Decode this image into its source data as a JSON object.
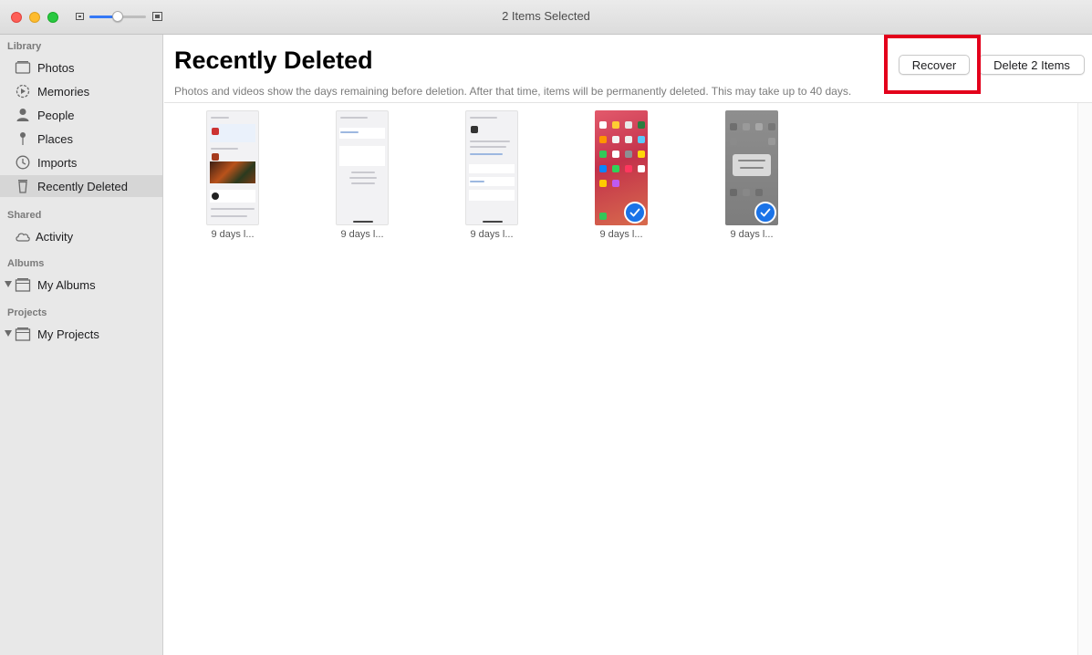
{
  "window": {
    "title": "2 Items Selected"
  },
  "sidebar": {
    "sections": {
      "library": "Library",
      "shared": "Shared",
      "albums": "Albums",
      "projects": "Projects"
    },
    "items": [
      {
        "label": "Photos",
        "icon": "photos-icon"
      },
      {
        "label": "Memories",
        "icon": "memories-icon"
      },
      {
        "label": "People",
        "icon": "people-icon"
      },
      {
        "label": "Places",
        "icon": "places-icon"
      },
      {
        "label": "Imports",
        "icon": "imports-icon"
      },
      {
        "label": "Recently Deleted",
        "icon": "trash-icon",
        "selected": true
      },
      {
        "label": "Activity",
        "icon": "cloud-icon"
      },
      {
        "label": "My Albums",
        "icon": "folder-icon"
      },
      {
        "label": "My Projects",
        "icon": "folder-icon"
      }
    ]
  },
  "main": {
    "title": "Recently Deleted",
    "subtitle": "Photos and videos show the days remaining before deletion. After that time, items will be permanently deleted. This may take up to 40 days.",
    "buttons": {
      "recover": "Recover",
      "delete": "Delete 2 Items"
    },
    "thumbnails": [
      {
        "caption": "9 days l...",
        "selected": false
      },
      {
        "caption": "9 days l...",
        "selected": false
      },
      {
        "caption": "9 days l...",
        "selected": false
      },
      {
        "caption": "9 days l...",
        "selected": true
      },
      {
        "caption": "9 days l...",
        "selected": true
      }
    ]
  },
  "colors": {
    "accent": "#1a73e8",
    "highlight": "#e3001b",
    "slider": "#3478f6"
  }
}
